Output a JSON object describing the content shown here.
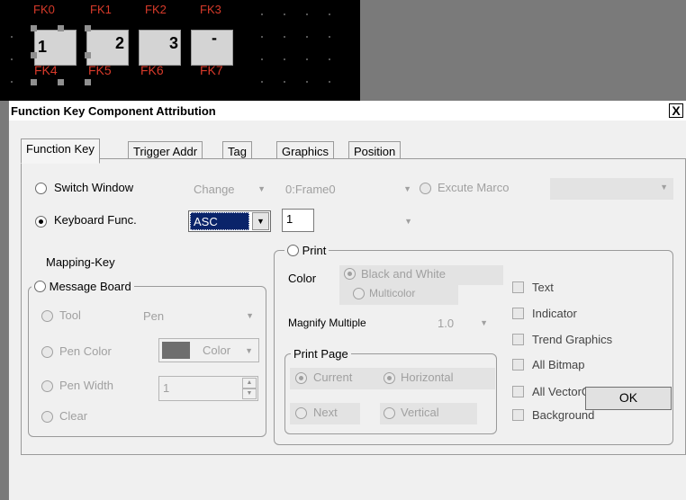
{
  "editor": {
    "top_labels": [
      "FK0",
      "FK1",
      "FK2",
      "FK3"
    ],
    "keys": [
      {
        "symbol": "1",
        "label": "FK4"
      },
      {
        "symbol": "2",
        "label": "FK5"
      },
      {
        "symbol": "3",
        "label": "FK6"
      },
      {
        "symbol": "-",
        "label": "FK7"
      }
    ]
  },
  "dialog": {
    "title": "Function Key Component Attribution",
    "close_label": "X",
    "tabs": [
      {
        "label": "Function Key",
        "active": true
      },
      {
        "label": "Trigger Addr"
      },
      {
        "label": "Tag"
      },
      {
        "label": "Graphics"
      },
      {
        "label": "Position"
      }
    ],
    "switch_window": {
      "label": "Switch Window",
      "mode_value": "Change",
      "frame_value": "0:Frame0"
    },
    "excute_marco": {
      "label": "Excute Marco",
      "value": ""
    },
    "keyboard_func": {
      "label": "Keyboard Func.",
      "value": "ASC",
      "key_value": "1",
      "secondary_value": ""
    },
    "mapping_key": {
      "label": "Mapping-Key"
    },
    "message_board": {
      "label": "Message Board",
      "tool": {
        "label": "Tool",
        "value": "Pen"
      },
      "pen_color": {
        "label": "Pen Color",
        "value": "Color",
        "swatch": "#6e6e6e"
      },
      "pen_width": {
        "label": "Pen Width",
        "value": "1"
      },
      "clear": {
        "label": "Clear"
      }
    },
    "print": {
      "label": "Print",
      "color_label": "Color",
      "black_white": "Black and White",
      "multicolor": "Multicolor",
      "magnify_label": "Magnify Multiple",
      "magnify_value": "1.0",
      "print_page": {
        "label": "Print Page",
        "current": "Current",
        "horizontal": "Horizontal",
        "next": "Next",
        "vertical": "Vertical"
      },
      "options": [
        "Text",
        "Indicator",
        "Trend Graphics",
        "All Bitmap",
        "All VectorGraph",
        "Background"
      ]
    },
    "ok_label": "OK"
  }
}
